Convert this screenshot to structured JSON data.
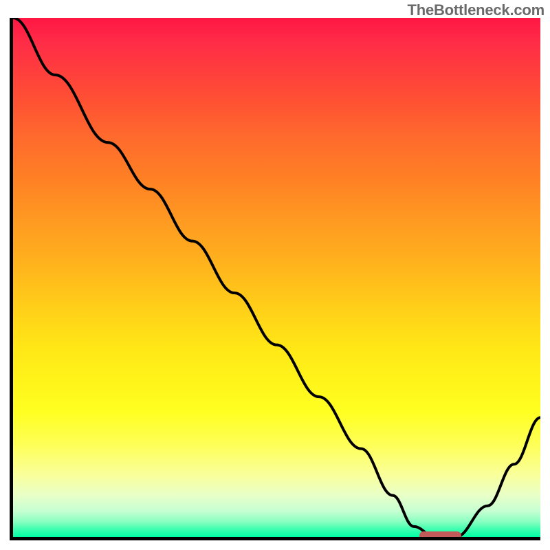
{
  "watermark": "TheBottleneck.com",
  "colors": {
    "axis": "#000000",
    "curve": "#000000",
    "marker": "#c35a5a",
    "gradient_top": "#ff1744",
    "gradient_mid": "#ffe816",
    "gradient_bottom": "#00ffa5"
  },
  "chart_data": {
    "type": "line",
    "title": "",
    "xlabel": "",
    "ylabel": "",
    "xlim": [
      0,
      100
    ],
    "ylim": [
      0,
      100
    ],
    "x": [
      0,
      8,
      18,
      26,
      34,
      42,
      50,
      58,
      66,
      72,
      76,
      80,
      84,
      90,
      95,
      100
    ],
    "values": [
      100,
      89,
      76,
      67,
      57,
      47,
      37,
      27,
      17,
      8,
      2,
      0,
      0,
      6,
      14,
      23
    ],
    "min_marker": {
      "x_start": 77,
      "x_end": 85,
      "y": 0
    },
    "annotations": [
      "TheBottleneck.com"
    ]
  }
}
